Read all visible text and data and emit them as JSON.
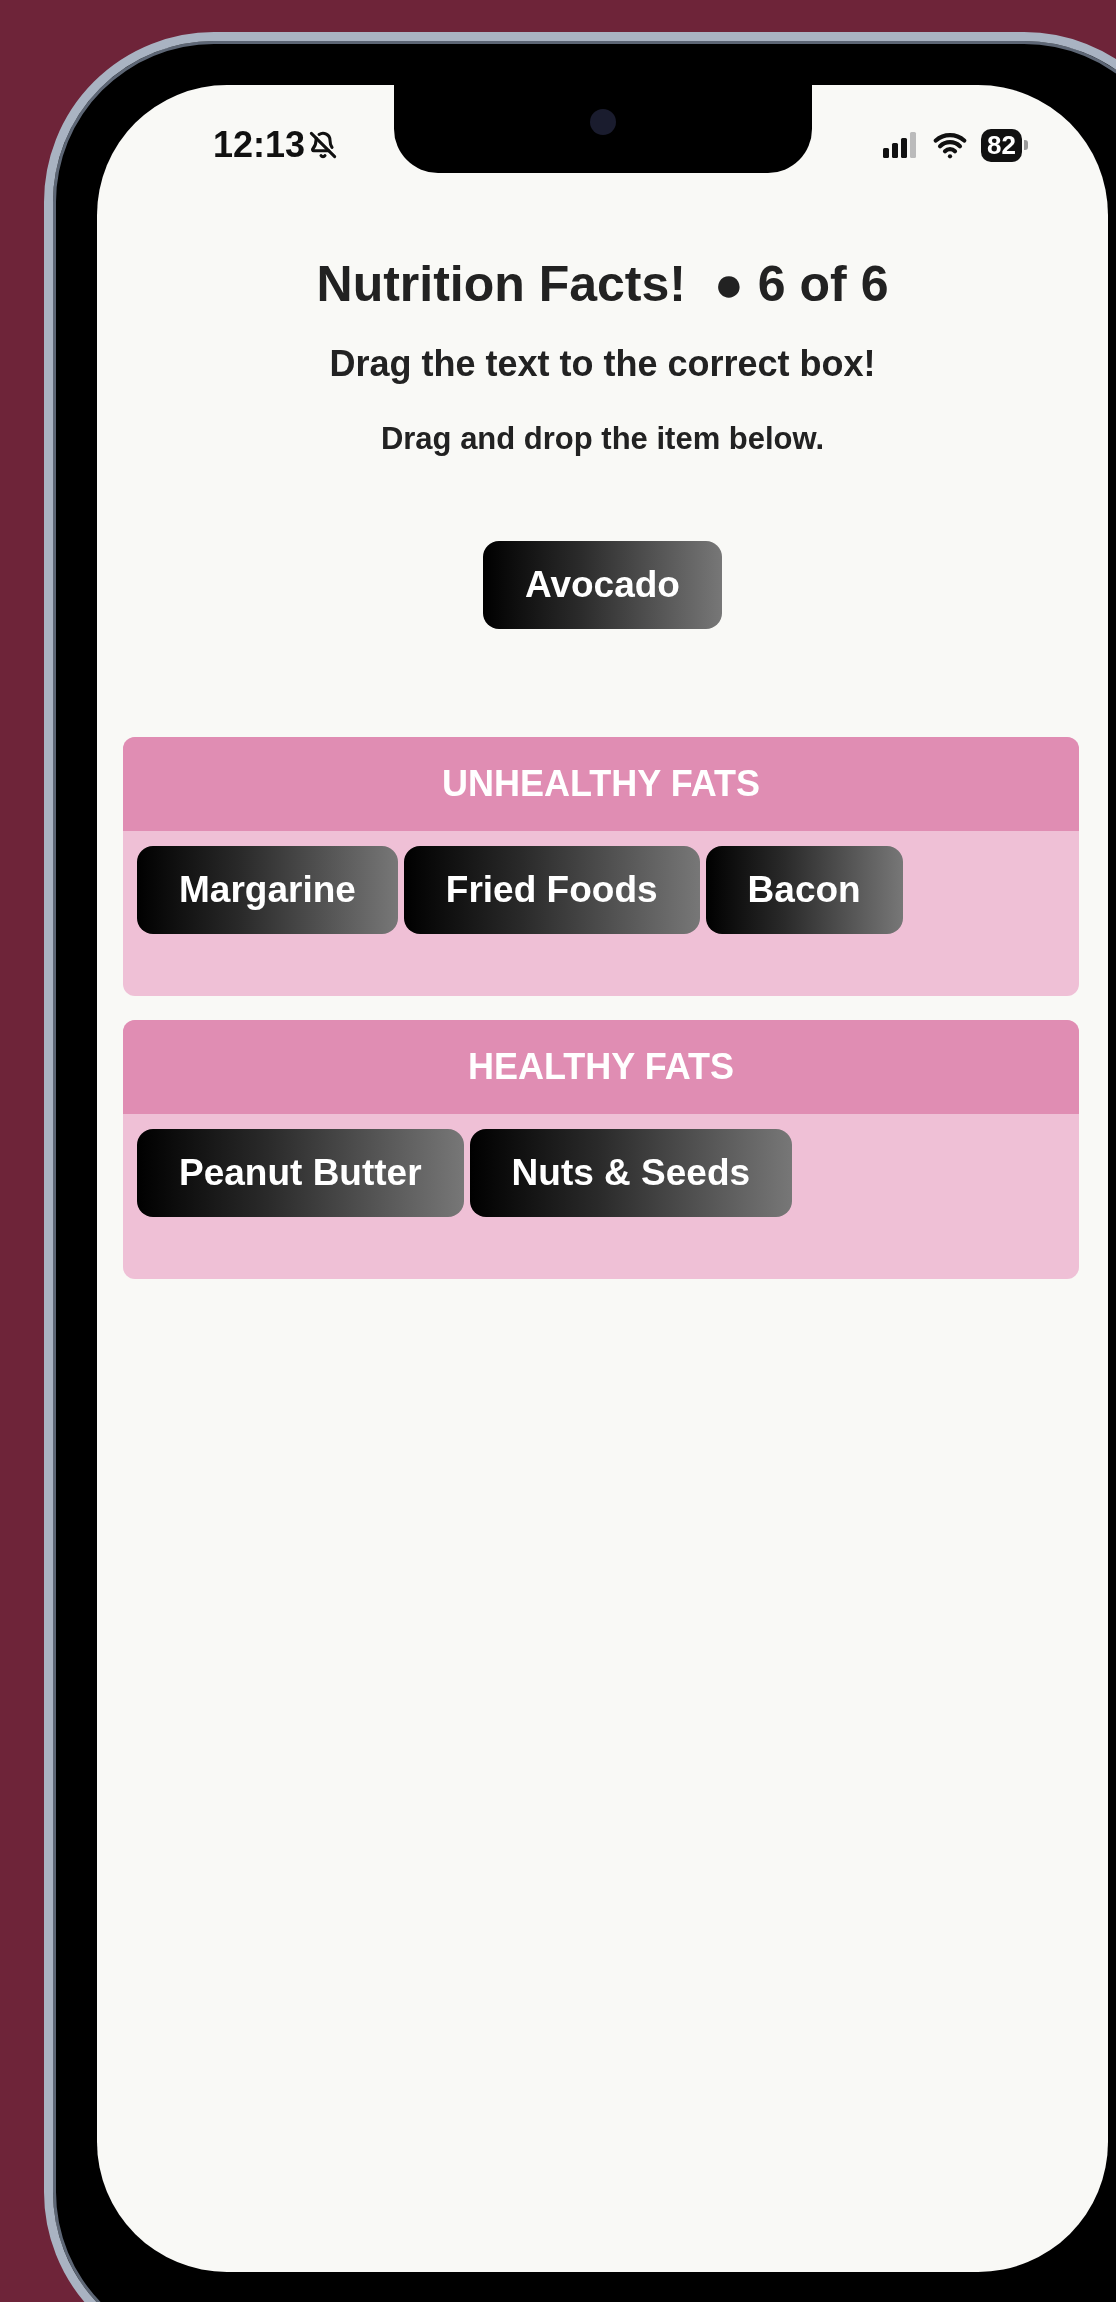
{
  "status_bar": {
    "time": "12:13",
    "battery": "82"
  },
  "title": "Nutrition Facts!  ● 6 of 6",
  "instruction": "Drag the text to the correct box!",
  "hint": "Drag and drop the item below.",
  "draggable_item": "Avocado",
  "categories": [
    {
      "title": "UNHEALTHY FATS",
      "items": [
        "Margarine",
        "Fried Foods",
        "Bacon"
      ]
    },
    {
      "title": "HEALTHY FATS",
      "items": [
        "Peanut Butter",
        "Nuts & Seeds"
      ]
    }
  ]
}
